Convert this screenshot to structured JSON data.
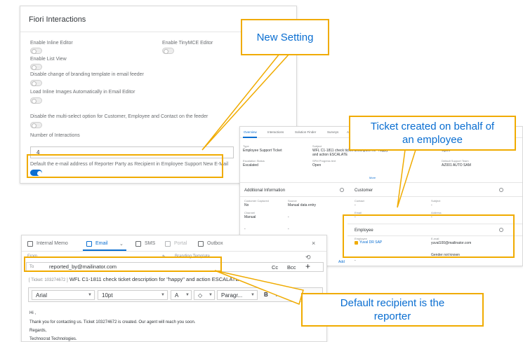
{
  "settings": {
    "title": "Fiori Interactions",
    "labels": {
      "enable_inline_editor": "Enable Inline Editor",
      "enable_tinymce_editor": "Enable TinyMCE Editor",
      "enable_list_view": "Enable List View",
      "disable_branding_change": "Disable change of branding template in email feeder",
      "load_inline_images": "Load Inline Images Automatically in Email Editor",
      "disable_multiselect": "Disable the multi-select option for Customer, Employee and Contact on the feeder",
      "number_of_interactions": "Number of Interactions",
      "default_reporter_email": "Default the e-mail address of Reporter Party as Recipient in Employee Support New E-Mail"
    },
    "number_of_interactions_value": "4"
  },
  "ticket": {
    "tabs": [
      "Overview",
      "Interactions",
      "Solution Finder",
      "Surveys",
      "Activities"
    ],
    "header": {
      "type_label": "Type",
      "type_value": "Employee Support Ticket",
      "subject_label": "Subject",
      "subject_value_1": "WFL C1-1811 check ticket description for \"happy\"",
      "subject_value_2": "and action ESCALATE",
      "escalation_label": "Escalation Status",
      "escalation_value": "Escalated",
      "progress_label": "SPM Progress text",
      "progress_value": "Open",
      "status_value": "Open",
      "support_team_label": "Default Support Team",
      "support_team_value": "AZ001 AUTO SAM",
      "more_link": "More"
    },
    "additional": {
      "title": "Additional Information",
      "reporter_label": "Customer Captured",
      "reporter_value": "No",
      "source_label": "Source",
      "source_value": "Manual data entry",
      "channel_label": "Channel",
      "channel_value": "Manual",
      "dash": "-",
      "add_link": "Add"
    },
    "customer": {
      "title": "Customer",
      "contact_label": "Contact",
      "subject_label": "Subject",
      "email_label": "Email",
      "address_label": "Address",
      "dash": "-"
    },
    "employee": {
      "title": "Employee",
      "employee_label": "Employee",
      "employee_value": "Yuval DR SAP",
      "email_label": "E-mail",
      "email_value": "yuval100@mailinator.com",
      "gender_value": "Gender not known"
    }
  },
  "email": {
    "tabs": {
      "internal_memo": "Internal Memo",
      "email": "Email",
      "sms": "SMS",
      "portal": "Portal",
      "outbox": "Outbox"
    },
    "from_label": "From",
    "branding_label": "Branding Template",
    "to_label": "To",
    "to_value": "reported_by@mailinator.com",
    "cc_label": "Cc",
    "bcc_label": "Bcc",
    "add_symbol": "+",
    "close_symbol": "×",
    "ticket_id": "[ Ticket: 103274672 ]",
    "subject": "WFL C1-1811 check ticket description for \"happy\" and action ESCALATE",
    "toolbar": {
      "font": "Arial",
      "size": "10pt",
      "text_color": "A",
      "format": "Paragr...",
      "bold": "B",
      "italic": "I"
    },
    "body": [
      "Hi ,",
      "Thank you for contacting us. Ticket 103274672 is created. Our agent will reach you soon.",
      "Regards,",
      "Technocrat Technologies."
    ]
  },
  "callouts": {
    "new_setting": "New Setting",
    "ticket_on_behalf_1": "Ticket created on behalf of",
    "ticket_on_behalf_2": "an employee",
    "default_recipient_1": "Default recipient is the",
    "default_recipient_2": "reporter"
  },
  "colors": {
    "callout_border": "#f0ab00",
    "callout_text": "#0a6ed1",
    "accent": "#0a6ed1"
  }
}
